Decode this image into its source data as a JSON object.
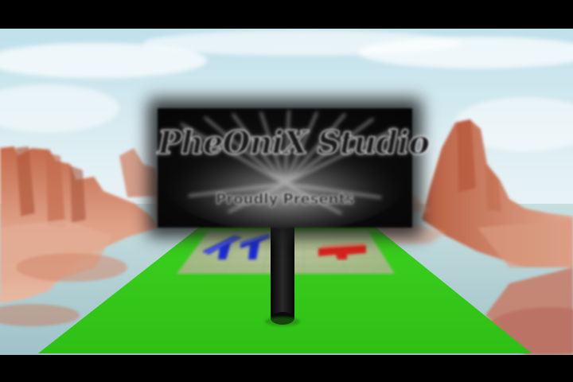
{
  "billboard": {
    "title": "PheOniX Studio",
    "subtitle": "Proudly Presents"
  },
  "colors": {
    "sky_top": "#cfe8f0",
    "sky_bottom": "#eef6f8",
    "ground_green": "#34c81c",
    "rock": "#d89a7c",
    "water": "#b8d6da",
    "blue_marker": "#1a2bd8",
    "red_marker": "#d8201a",
    "billboard_face": "#0a0a0a",
    "pole": "#111111"
  },
  "scene_objects": [
    "sky",
    "canyon-rocks",
    "water",
    "green-platform",
    "spawn-pad",
    "blue-marker",
    "red-marker",
    "pole",
    "billboard"
  ]
}
